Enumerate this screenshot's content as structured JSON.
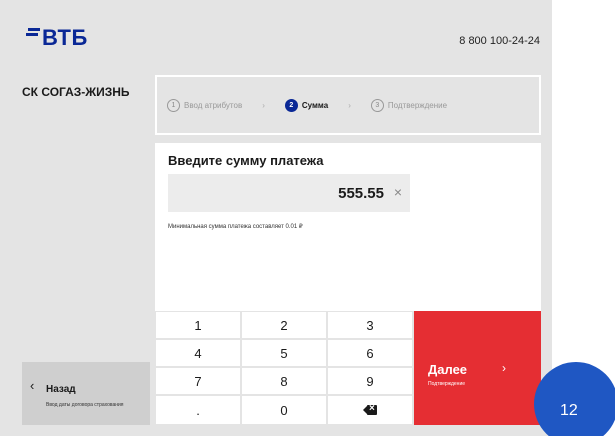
{
  "header": {
    "logo_text": "ВТБ",
    "phone": "8 800 100-24-24"
  },
  "org_name": "СК СОГАЗ-ЖИЗНЬ",
  "steps": [
    {
      "num": "1",
      "label": "Ввод атрибутов",
      "active": false
    },
    {
      "num": "2",
      "label": "Сумма",
      "active": true
    },
    {
      "num": "3",
      "label": "Подтверждение",
      "active": false
    }
  ],
  "step_separator": "›",
  "payment": {
    "title": "Введите сумму платежа",
    "amount": "555.55",
    "clear_symbol": "×",
    "min_note": "Минимальная сумма платежа составляет 0.01 ₽"
  },
  "keypad": {
    "keys": [
      "1",
      "2",
      "3",
      "4",
      "5",
      "6",
      "7",
      "8",
      "9",
      ".",
      "0"
    ],
    "backspace_icon": "backspace-icon"
  },
  "next_button": {
    "label": "Далее",
    "sub": "Подтверждение",
    "chevron": "›"
  },
  "back_button": {
    "label": "Назад",
    "sub": "Ввод даты договора страхования",
    "chevron": "‹"
  },
  "badge": {
    "text": "12"
  },
  "colors": {
    "brand_blue": "#0a2896",
    "accent_red": "#e52e33",
    "badge_blue": "#1f57c3"
  }
}
